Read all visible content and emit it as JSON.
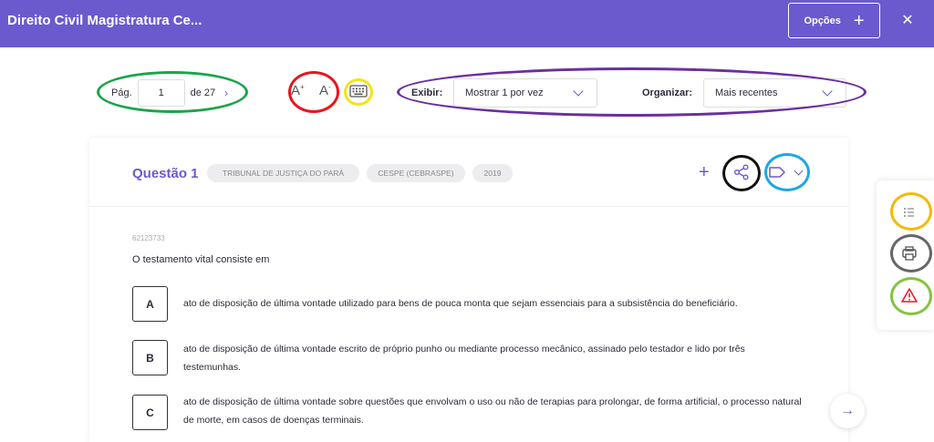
{
  "header": {
    "title": "Direito Civil Magistratura Ce...",
    "options_label": "Opções",
    "options_plus": "+",
    "close": "✕"
  },
  "pager": {
    "prev": "‹",
    "label": "Pág.",
    "current": "1",
    "total_label": "de 27",
    "next": "›"
  },
  "font_tools": {
    "increase": "A",
    "increase_sup": "+",
    "decrease": "A",
    "decrease_sup": "-"
  },
  "filters": {
    "display_label": "Exibir:",
    "display_value": "Mostrar 1 por vez",
    "sort_label": "Organizar:",
    "sort_value": "Mais recentes"
  },
  "question": {
    "title": "Questão 1",
    "tags": [
      "TRIBUNAL DE JUSTIÇA DO PARÁ",
      "CESPE (CEBRASPE)",
      "2019"
    ],
    "add": "+",
    "code": "62123733",
    "statement": "O testamento vital consiste em",
    "alternatives": [
      {
        "letter": "A",
        "text": "ato de disposição de última vontade utilizado para bens de pouca monta que sejam essenciais para a subsistência do beneficiário."
      },
      {
        "letter": "B",
        "text": "ato de disposição de última vontade escrito de próprio punho ou mediante processo mecânico, assinado pelo testador e lido por três testemunhas."
      },
      {
        "letter": "C",
        "text": "ato de disposição de última vontade sobre questões que envolvam o uso ou não de terapias para prolongar, de forma artificial, o processo natural de morte, em casos de doenças terminais."
      }
    ]
  },
  "next_fab": "→",
  "colors": {
    "brand": "#6a5acd",
    "ring_green": "#1aa54a",
    "ring_red": "#e8141e",
    "ring_yellow": "#f5e21b",
    "ring_purple": "#6b2fa0",
    "ring_black": "#111111",
    "ring_blue": "#1fa6e6",
    "ring_orange": "#f5b90a",
    "ring_gray": "#666666",
    "ring_lime": "#84c341"
  }
}
